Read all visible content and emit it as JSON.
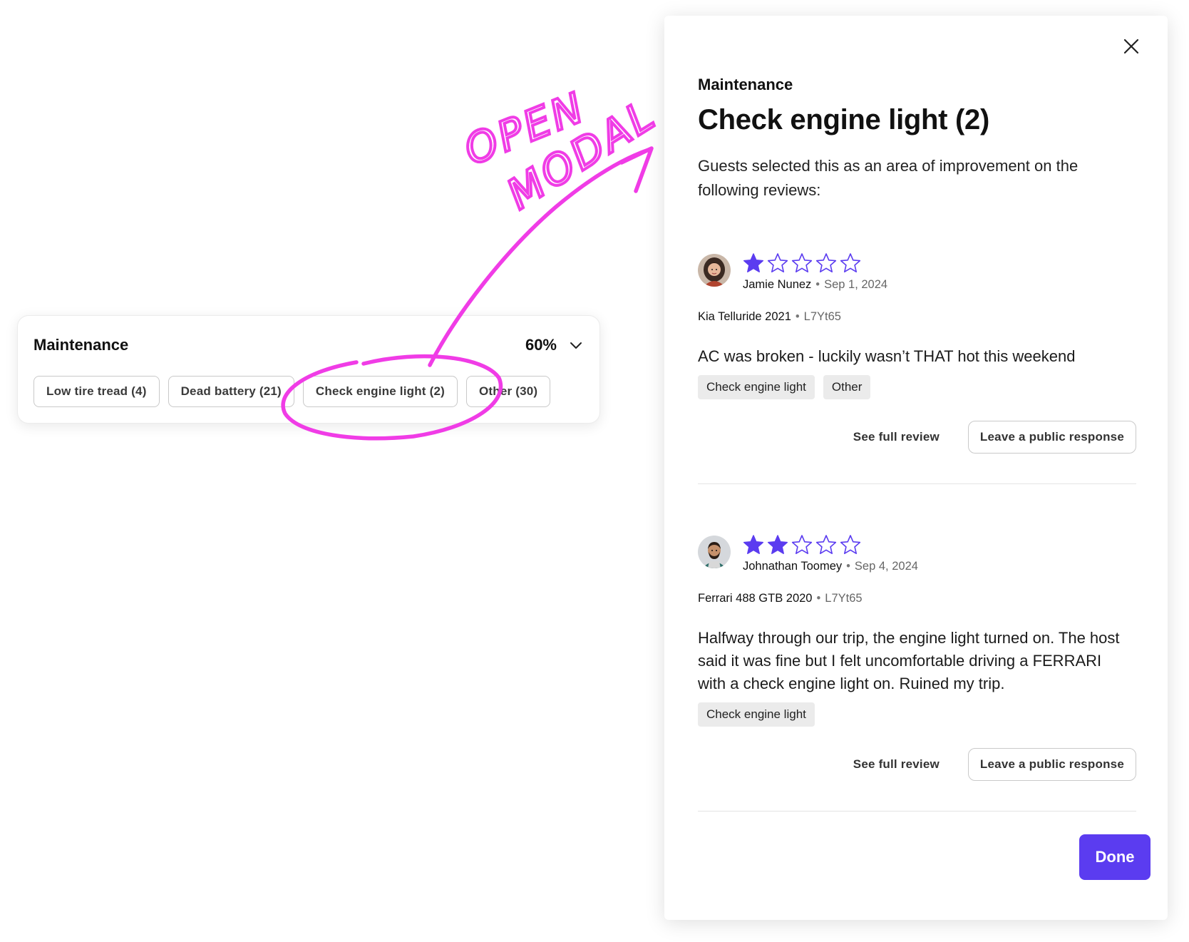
{
  "card": {
    "title": "Maintenance",
    "percent": "60%",
    "chips": [
      {
        "label": "Low tire tread (4)"
      },
      {
        "label": "Dead battery (21)"
      },
      {
        "label": "Check engine light (2)"
      },
      {
        "label": "Other (30)"
      }
    ]
  },
  "annotation": {
    "line1": "OPEN",
    "line2": "MODAL",
    "color": "#f03ce6"
  },
  "modal": {
    "eyebrow": "Maintenance",
    "title": "Check engine light (2)",
    "description": "Guests selected this as an area of improvement on the following reviews:",
    "done_label": "Done",
    "accent_color": "#5b3cf0",
    "reviews": [
      {
        "rating": 1,
        "max_rating": 5,
        "reviewer": "Jamie Nunez",
        "date": "Sep 1, 2024",
        "vehicle": "Kia Telluride 2021",
        "code": "L7Yt65",
        "text": "AC was broken - luckily wasn’t THAT hot this weekend",
        "tags": [
          "Check engine light",
          "Other"
        ],
        "see_full_label": "See full review",
        "respond_label": "Leave a public response"
      },
      {
        "rating": 2,
        "max_rating": 5,
        "reviewer": "Johnathan Toomey",
        "date": "Sep 4, 2024",
        "vehicle": "Ferrari 488 GTB 2020",
        "code": "L7Yt65",
        "text": "Halfway through our trip, the engine light turned on. The host said it was fine but I felt uncomfortable driving a FERRARI with a check engine light on. Ruined my trip.",
        "tags": [
          "Check engine light"
        ],
        "see_full_label": "See full review",
        "respond_label": "Leave a public response"
      }
    ]
  }
}
